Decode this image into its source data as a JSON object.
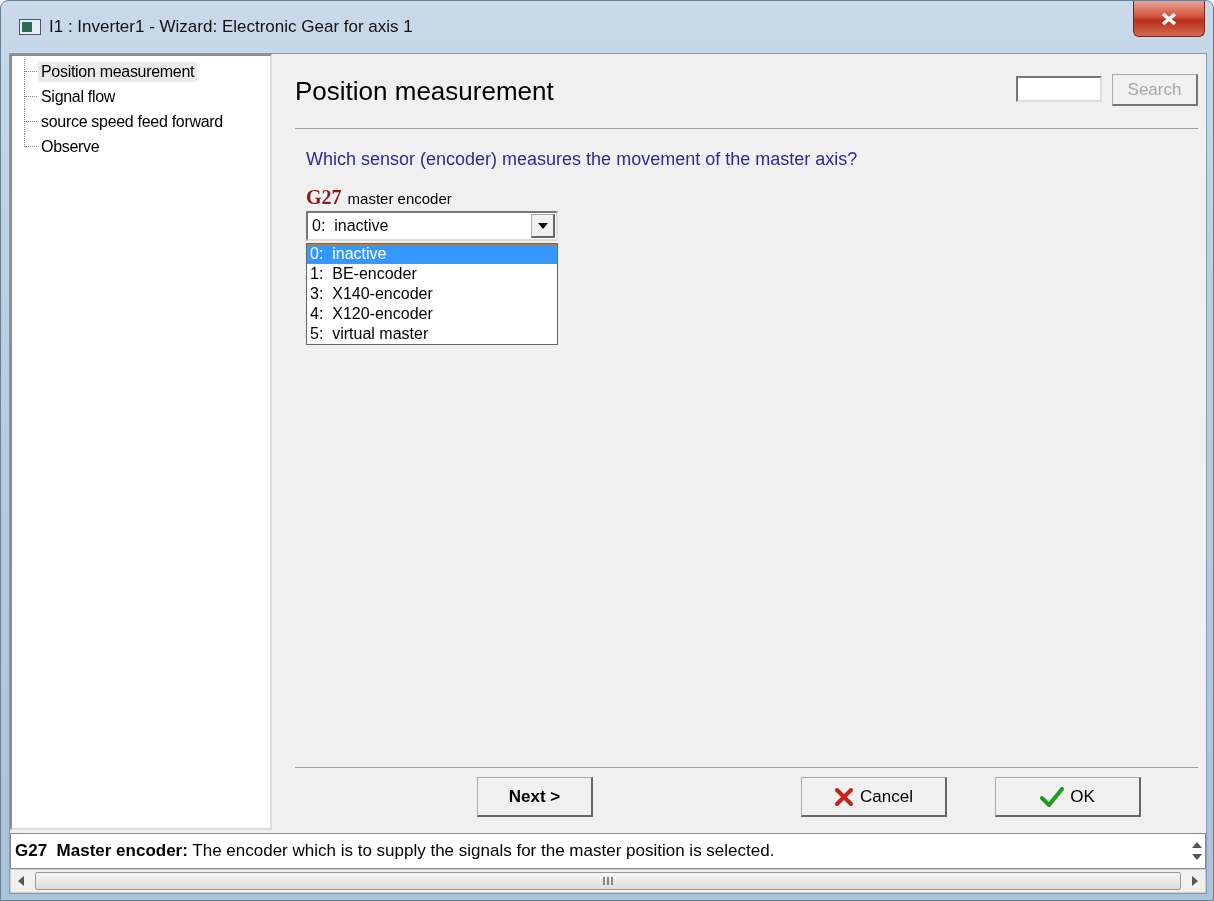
{
  "window": {
    "title": "I1 : Inverter1 - Wizard: Electronic Gear for axis 1"
  },
  "tree": {
    "items": [
      {
        "label": "Position measurement",
        "selected": true
      },
      {
        "label": "Signal flow",
        "selected": false
      },
      {
        "label": "source speed feed forward",
        "selected": false
      },
      {
        "label": "Observe",
        "selected": false
      }
    ]
  },
  "page": {
    "title": "Position measurement",
    "search": {
      "button": "Search",
      "disabled": true
    },
    "question": "Which sensor (encoder) measures the movement of the master axis?",
    "parameter": {
      "code": "G27",
      "label": "master encoder",
      "value": "0:  inactive",
      "expanded": true,
      "options": [
        {
          "label": "0:  inactive",
          "selected": true
        },
        {
          "label": "1:  BE-encoder",
          "selected": false
        },
        {
          "label": "3:  X140-encoder",
          "selected": false
        },
        {
          "label": "4:  X120-encoder",
          "selected": false
        },
        {
          "label": "5:  virtual master",
          "selected": false
        }
      ]
    }
  },
  "buttons": [
    {
      "kind": "next",
      "label": "Next >"
    },
    {
      "kind": "cancel",
      "label": "Cancel"
    },
    {
      "kind": "ok",
      "label": "OK"
    }
  ],
  "help": "**G27  Master encoder:** The encoder which is to supply the signals for the master position is selected."
}
